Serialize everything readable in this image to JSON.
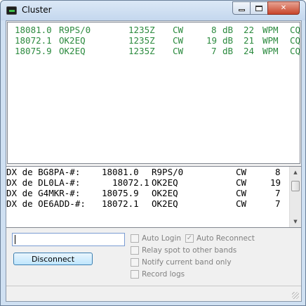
{
  "window": {
    "title": "Cluster",
    "icon": "terminal-icon"
  },
  "titlebar": {
    "minimize_icon": "minimize-icon",
    "maximize_icon": "maximize-icon",
    "close_glyph": "✕"
  },
  "spots": [
    {
      "freq": "18081.0",
      "call": "R9PS/0",
      "time": "1235Z",
      "mode": "CW",
      "snr": "8",
      "snr_unit": "dB",
      "wpm": "22",
      "wpm_unit": "WPM",
      "extra": "CQ"
    },
    {
      "freq": "18072.1",
      "call": "OK2EQ",
      "time": "1235Z",
      "mode": "CW",
      "snr": "19",
      "snr_unit": "dB",
      "wpm": "21",
      "wpm_unit": "WPM",
      "extra": "CQ"
    },
    {
      "freq": "18075.9",
      "call": "OK2EQ",
      "time": "1235Z",
      "mode": "CW",
      "snr": "7",
      "snr_unit": "dB",
      "wpm": "24",
      "wpm_unit": "WPM",
      "extra": "CQ"
    }
  ],
  "raw_lines": [
    {
      "spotter": "DX de BG8PA-#:",
      "freq": "18081.0",
      "call": "R9PS/0",
      "mode": "CW",
      "num": "8"
    },
    {
      "spotter": "DX de DL0LA-#:",
      "freq": "18072.1",
      "call": "OK2EQ",
      "mode": "CW",
      "num": "19"
    },
    {
      "spotter": "DX de G4MKR-#:",
      "freq": "18075.9",
      "call": "OK2EQ",
      "mode": "CW",
      "num": "7"
    },
    {
      "spotter": "DX de OE6ADD-#:",
      "freq": "18072.1",
      "call": "OK2EQ",
      "mode": "CW",
      "num": "7"
    }
  ],
  "controls": {
    "callsign_value": "",
    "disconnect_label": "Disconnect",
    "options": {
      "auto_login": {
        "label": "Auto Login",
        "checked": false
      },
      "auto_reconnect": {
        "label": "Auto Reconnect",
        "checked": true
      },
      "relay_spot": {
        "label": "Relay spot to other bands",
        "checked": false
      },
      "notify_band": {
        "label": "Notify current band only",
        "checked": false
      },
      "record_logs": {
        "label": "Record logs",
        "checked": false
      }
    }
  },
  "colors": {
    "spot_text": "#2b8a3e",
    "title_bar": "#cfe0f2"
  }
}
